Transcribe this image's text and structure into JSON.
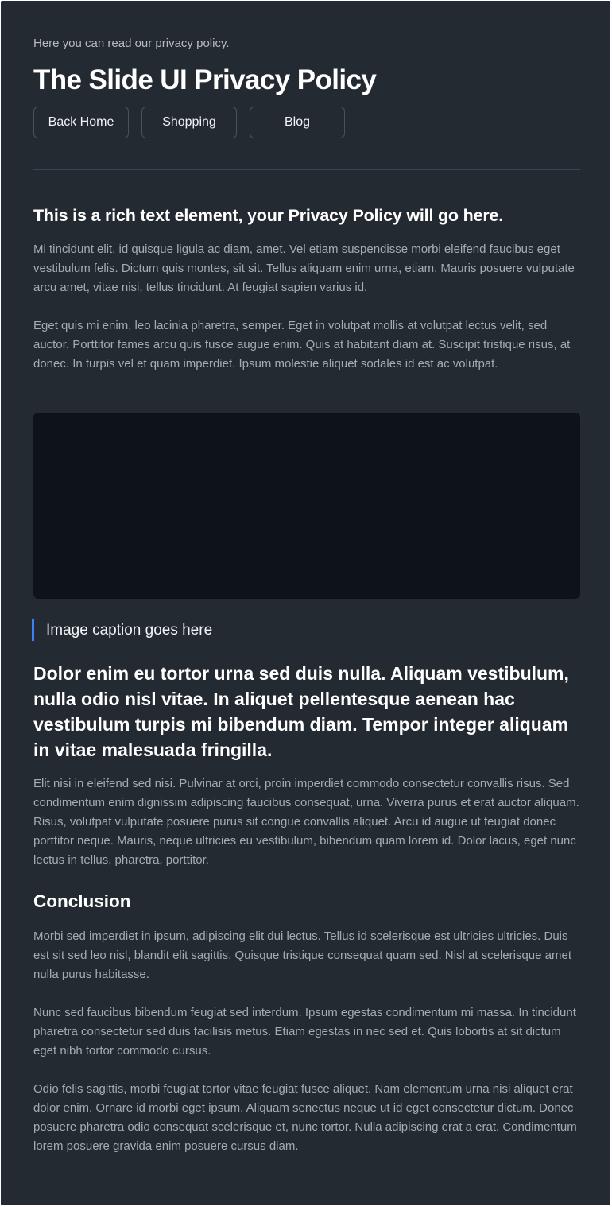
{
  "header": {
    "intro": "Here you can read our privacy policy.",
    "title": "The Slide UI Privacy Policy",
    "buttons": [
      "Back Home",
      "Shopping",
      "Blog"
    ]
  },
  "section1": {
    "heading": "This is a rich text element, your Privacy Policy will go here.",
    "paragraphs": [
      "Mi tincidunt elit, id quisque ligula ac diam, amet. Vel etiam suspendisse morbi eleifend faucibus eget vestibulum felis. Dictum quis montes, sit sit. Tellus aliquam enim urna, etiam. Mauris posuere vulputate arcu amet, vitae nisi, tellus tincidunt. At feugiat sapien varius id.",
      "Eget quis mi enim, leo lacinia pharetra, semper. Eget in volutpat mollis at volutpat lectus velit, sed auctor. Porttitor fames arcu quis fusce augue enim. Quis at habitant diam at. Suscipit tristique risus, at donec. In turpis vel et quam imperdiet. Ipsum molestie aliquet sodales id est ac volutpat."
    ]
  },
  "figure": {
    "caption": "Image caption goes here"
  },
  "section2": {
    "quote": "Dolor enim eu tortor urna sed duis nulla. Aliquam vestibulum, nulla odio nisl vitae. In aliquet pellentesque aenean hac vestibulum turpis mi bibendum diam. Tempor integer aliquam in vitae malesuada fringilla.",
    "paragraph": "Elit nisi in eleifend sed nisi. Pulvinar at orci, proin imperdiet commodo consectetur convallis risus. Sed condimentum enim dignissim adipiscing faucibus consequat, urna. Viverra purus et erat auctor aliquam. Risus, volutpat vulputate posuere purus sit congue convallis aliquet. Arcu id augue ut feugiat donec porttitor neque. Mauris, neque ultricies eu vestibulum, bibendum quam lorem id. Dolor lacus, eget nunc lectus in tellus, pharetra, porttitor."
  },
  "conclusion": {
    "heading": "Conclusion",
    "paragraphs": [
      "Morbi sed imperdiet in ipsum, adipiscing elit dui lectus. Tellus id scelerisque est ultricies ultricies. Duis est sit sed leo nisl, blandit elit sagittis. Quisque tristique consequat quam sed. Nisl at scelerisque amet nulla purus habitasse.",
      "Nunc sed faucibus bibendum feugiat sed interdum. Ipsum egestas condimentum mi massa. In tincidunt pharetra consectetur sed duis facilisis metus. Etiam egestas in nec sed et. Quis lobortis at sit dictum eget nibh tortor commodo cursus.",
      "Odio felis sagittis, morbi feugiat tortor vitae feugiat fusce aliquet. Nam elementum urna nisi aliquet erat dolor enim. Ornare id morbi eget ipsum. Aliquam senectus neque ut id eget consectetur dictum. Donec posuere pharetra odio consequat scelerisque et, nunc tortor. Nulla adipiscing erat a erat. Condimentum lorem posuere gravida enim posuere cursus diam."
    ]
  },
  "colors": {
    "background": "#242a31",
    "image_placeholder": "#0e131a",
    "caption_accent": "#3b82f6",
    "heading_text": "#ffffff",
    "body_text": "#a4abb3"
  }
}
